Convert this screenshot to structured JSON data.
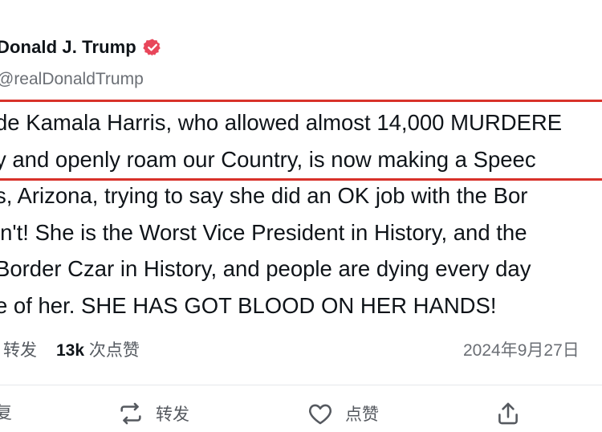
{
  "post": {
    "author_name": "Donald J. Trump",
    "author_handle": "@realDonaldTrump",
    "verified_icon": "verified-badge-icon",
    "accent_color": "#e8465a",
    "lines": [
      "de Kamala Harris, who allowed almost 14,000 MURDERE",
      "y and openly roam our Country, is now making a Speec",
      "s, Arizona, trying to say she did an OK job with the Bor",
      "ln't! She is the Worst Vice President in History, and the",
      "Border Czar in History, and people are dying every day",
      "e of her. SHE HAS GOT BLOOD ON HER HANDS!"
    ],
    "highlight_color": "#d8322a"
  },
  "stats": {
    "repost_label": "转发",
    "like_count": "13k",
    "like_label": "次点赞",
    "timestamp": "2024年9月27日"
  },
  "actions": {
    "reply_label": "复",
    "repost_label": "转发",
    "like_label": "点赞",
    "icons": [
      "reply-icon",
      "repost-icon",
      "heart-icon",
      "share-icon"
    ]
  }
}
